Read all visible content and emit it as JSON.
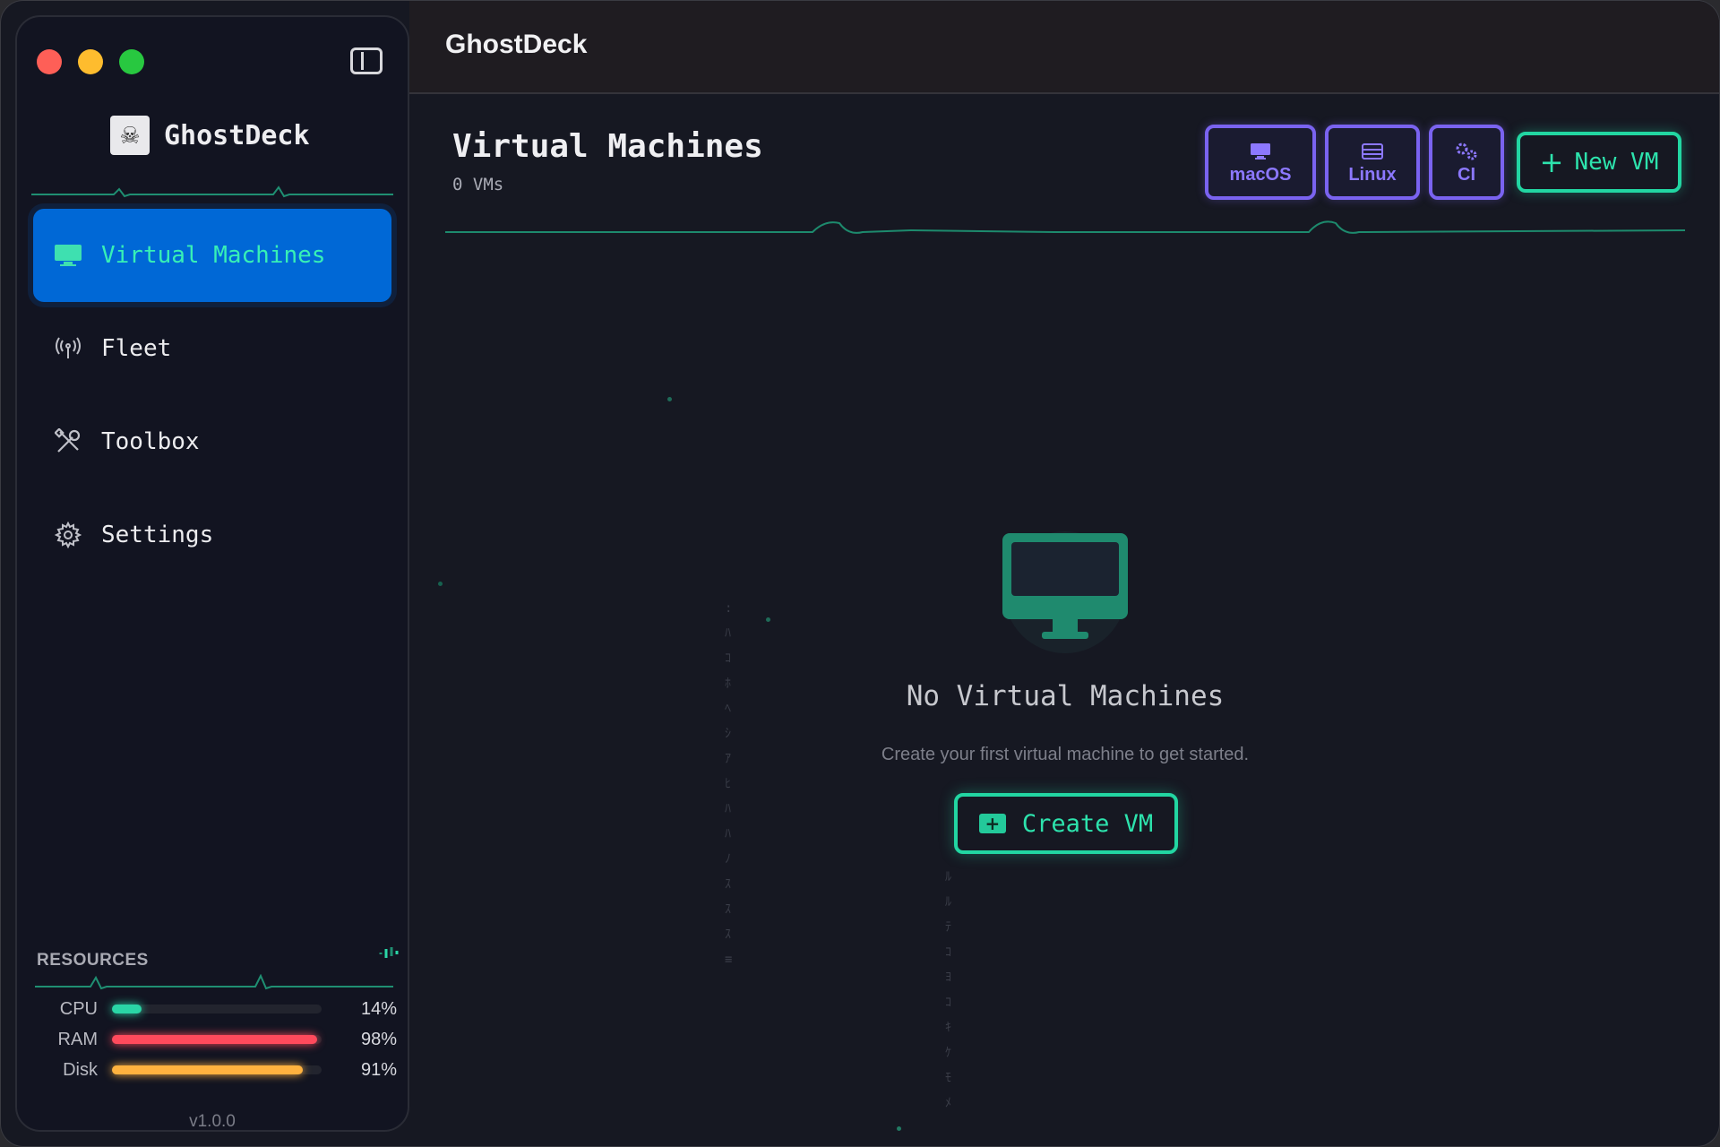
{
  "app": {
    "title": "GhostDeck",
    "brand_name": "GhostDeck"
  },
  "sidebar": {
    "items": [
      {
        "label": "Virtual Machines",
        "icon": "monitor-icon",
        "active": true
      },
      {
        "label": "Fleet",
        "icon": "antenna-icon",
        "active": false
      },
      {
        "label": "Toolbox",
        "icon": "tools-icon",
        "active": false
      },
      {
        "label": "Settings",
        "icon": "gear-icon",
        "active": false
      }
    ],
    "resources": {
      "title": "RESOURCES",
      "rows": [
        {
          "name": "CPU",
          "value": "14%",
          "fraction": 0.14,
          "color": "#2ad6a6"
        },
        {
          "name": "RAM",
          "value": "98%",
          "fraction": 0.98,
          "color": "#ff4a5c"
        },
        {
          "name": "Disk",
          "value": "91%",
          "fraction": 0.91,
          "color": "#ffb23f"
        }
      ]
    },
    "version": "v1.0.0"
  },
  "main": {
    "title": "Virtual Machines",
    "subtitle": "0 VMs",
    "os_buttons": [
      {
        "label": "macOS",
        "icon": "monitor-icon"
      },
      {
        "label": "Linux",
        "icon": "server-icon"
      },
      {
        "label": "CI",
        "icon": "gears-icon"
      }
    ],
    "new_vm_label": "New VM",
    "empty_state": {
      "title": "No Virtual Machines",
      "description": "Create your first virtual machine to get started.",
      "button_label": "Create VM"
    }
  },
  "colors": {
    "accent": "#22d6a2",
    "active_nav": "#0068d6",
    "os_button": "#7a63f0"
  }
}
